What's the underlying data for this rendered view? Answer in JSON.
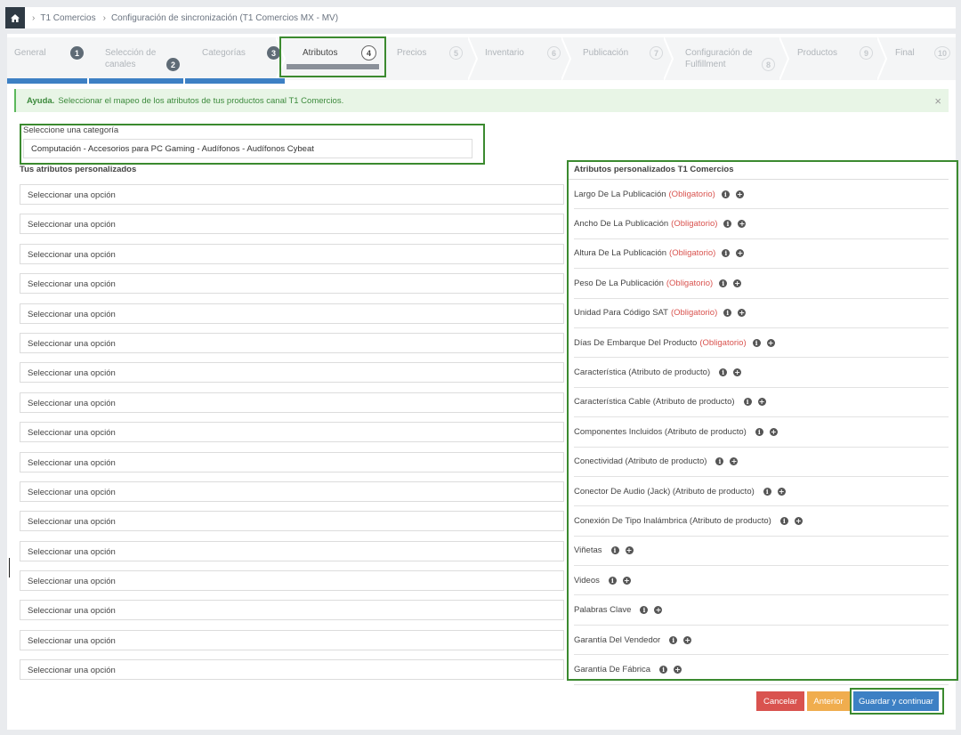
{
  "breadcrumb": {
    "items": [
      {
        "label": "T1 Comercios"
      },
      {
        "label": "Configuración de sincronización (T1 Comercios MX - MV)"
      }
    ]
  },
  "wizard": {
    "steps": [
      {
        "label": "General",
        "num": "1",
        "state": "done"
      },
      {
        "label": "Selección de canales",
        "num": "2",
        "state": "done"
      },
      {
        "label": "Categorías",
        "num": "3",
        "state": "done"
      },
      {
        "label": "Atributos",
        "num": "4",
        "state": "current"
      },
      {
        "label": "Precios",
        "num": "5",
        "state": "todo"
      },
      {
        "label": "Inventario",
        "num": "6",
        "state": "todo"
      },
      {
        "label": "Publicación",
        "num": "7",
        "state": "todo"
      },
      {
        "label": "Configuración de Fulfillment",
        "num": "8",
        "state": "todo"
      },
      {
        "label": "Productos",
        "num": "9",
        "state": "todo"
      },
      {
        "label": "Final",
        "num": "10",
        "state": "todo"
      }
    ]
  },
  "help": {
    "title": "Ayuda.",
    "text": "Seleccionar el mapeo de los atributos de tus productos canal T1 Comercios.",
    "close": "×"
  },
  "category": {
    "label": "Seleccione una categoría",
    "value": "Computación - Accesorios para PC Gaming - Audífonos - Audífonos Cybeat"
  },
  "columns": {
    "left": "Tus atributos personalizados",
    "right": "Atributos personalizados T1 Comercios"
  },
  "placeholder": "Seleccionar una opción",
  "attributes": [
    {
      "name": "Largo De La Publicación",
      "tag": "(Obligatorio)"
    },
    {
      "name": "Ancho De La Publicación",
      "tag": "(Obligatorio)"
    },
    {
      "name": "Altura De La Publicación",
      "tag": "(Obligatorio)"
    },
    {
      "name": "Peso De La Publicación",
      "tag": "(Obligatorio)"
    },
    {
      "name": "Unidad Para Código SAT",
      "tag": "(Obligatorio)"
    },
    {
      "name": "Días De Embarque Del Producto",
      "tag": "(Obligatorio)"
    },
    {
      "name": "Característica (Atributo de producto)",
      "tag": ""
    },
    {
      "name": "Característica Cable (Atributo de producto)",
      "tag": ""
    },
    {
      "name": "Componentes Incluidos (Atributo de producto)",
      "tag": ""
    },
    {
      "name": "Conectividad (Atributo de producto)",
      "tag": ""
    },
    {
      "name": "Conector De Audio (Jack) (Atributo de producto)",
      "tag": ""
    },
    {
      "name": "Conexión De Tipo Inalámbrica (Atributo de producto)",
      "tag": ""
    },
    {
      "name": "Viñetas",
      "tag": ""
    },
    {
      "name": "Videos",
      "tag": ""
    },
    {
      "name": "Palabras Clave",
      "tag": ""
    },
    {
      "name": "Garantía Del Vendedor",
      "tag": ""
    },
    {
      "name": "Garantía De Fábrica",
      "tag": ""
    }
  ],
  "buttons": {
    "cancel": "Cancelar",
    "prev": "Anterior",
    "save": "Guardar y continuar"
  },
  "colors": {
    "primary": "#3d80c4",
    "danger": "#d9534f",
    "warning": "#f0ad4e",
    "highlight": "#3b8a2f"
  },
  "icons": {
    "info": "info-icon",
    "add": "plus-circle-icon",
    "home": "home-icon"
  }
}
